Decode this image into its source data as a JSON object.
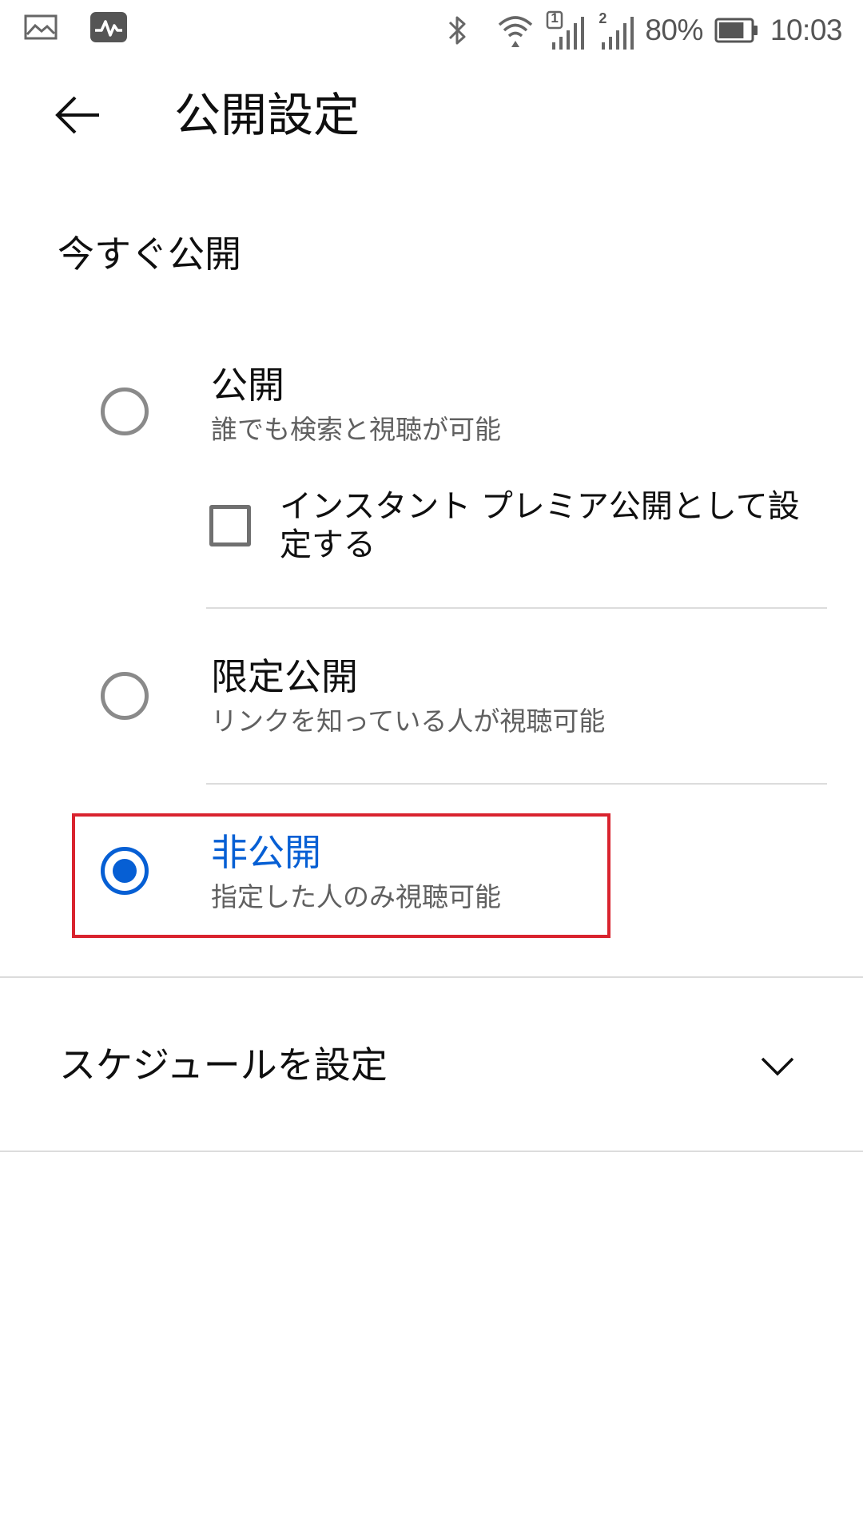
{
  "status_bar": {
    "left_icons": [
      "gallery-icon",
      "activity-icon"
    ],
    "right_icons": [
      "bluetooth-icon",
      "wifi-icon",
      "signal-sim1-icon",
      "signal-sim2-icon",
      "battery-icon"
    ],
    "sim1_label": "1",
    "sim2_label": "2",
    "battery_percent": "80%",
    "battery_level": 0.8,
    "time": "10:03"
  },
  "header": {
    "back_icon": "arrow-left-icon",
    "title": "公開設定"
  },
  "section": {
    "title": "今すぐ公開"
  },
  "options": [
    {
      "title": "公開",
      "subtitle": "誰でも検索と視聴が可能",
      "selected": false
    },
    {
      "title": "限定公開",
      "subtitle": "リンクを知っている人が視聴可能",
      "selected": false
    },
    {
      "title": "非公開",
      "subtitle": "指定した人のみ視聴可能",
      "selected": true
    }
  ],
  "instant_premiere": {
    "label": "インスタント プレミア公開として設定する",
    "checked": false
  },
  "schedule": {
    "label": "スケジュールを設定",
    "icon": "chevron-down-icon"
  },
  "colors": {
    "accent": "#065fd4",
    "highlight_border": "#d9232e",
    "divider": "#dcdcdc",
    "text_primary": "#0f0f0f",
    "text_secondary": "#606060"
  }
}
